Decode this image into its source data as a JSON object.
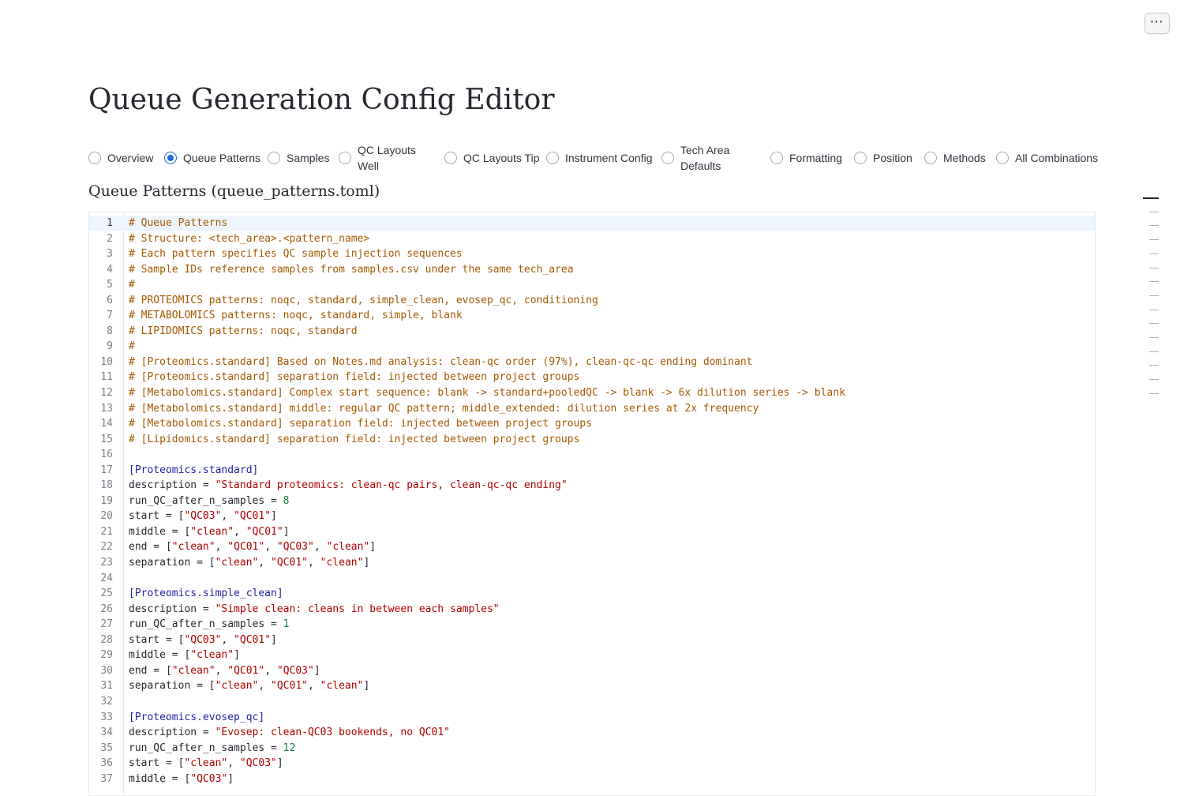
{
  "menu": {
    "label": "···"
  },
  "page": {
    "title": "Queue Generation Config Editor"
  },
  "tabs": [
    {
      "label": "Overview",
      "selected": false
    },
    {
      "label": "Queue Patterns",
      "selected": true
    },
    {
      "label": "Samples",
      "selected": false
    },
    {
      "label": "QC Layouts Well",
      "selected": false
    },
    {
      "label": "QC Layouts Tip",
      "selected": false
    },
    {
      "label": "Instrument Config",
      "selected": false
    },
    {
      "label": "Tech Area Defaults",
      "selected": false
    },
    {
      "label": "Formatting",
      "selected": false
    },
    {
      "label": "Position",
      "selected": false
    },
    {
      "label": "Methods",
      "selected": false
    },
    {
      "label": "All Combinations",
      "selected": false
    }
  ],
  "section": {
    "heading": "Queue Patterns (queue_patterns.toml)"
  },
  "editor": {
    "lines": [
      [
        [
          "c",
          "# Queue Patterns"
        ]
      ],
      [
        [
          "c",
          "# Structure: <tech_area>.<pattern_name>"
        ]
      ],
      [
        [
          "c",
          "# Each pattern specifies QC sample injection sequences"
        ]
      ],
      [
        [
          "c",
          "# Sample IDs reference samples from samples.csv under the same tech_area"
        ]
      ],
      [
        [
          "c",
          "#"
        ]
      ],
      [
        [
          "c",
          "# PROTEOMICS patterns: noqc, standard, simple_clean, evosep_qc, conditioning"
        ]
      ],
      [
        [
          "c",
          "# METABOLOMICS patterns: noqc, standard, simple, blank"
        ]
      ],
      [
        [
          "c",
          "# LIPIDOMICS patterns: noqc, standard"
        ]
      ],
      [
        [
          "c",
          "#"
        ]
      ],
      [
        [
          "c",
          "# [Proteomics.standard] Based on Notes.md analysis: clean-qc order (97%), clean-qc-qc ending dominant"
        ]
      ],
      [
        [
          "c",
          "# [Proteomics.standard] separation field: injected between project groups"
        ]
      ],
      [
        [
          "c",
          "# [Metabolomics.standard] Complex start sequence: blank -> standard+pooledQC -> blank -> 6x dilution series -> blank"
        ]
      ],
      [
        [
          "c",
          "# [Metabolomics.standard] middle: regular QC pattern; middle_extended: dilution series at 2x frequency"
        ]
      ],
      [
        [
          "c",
          "# [Metabolomics.standard] separation field: injected between project groups"
        ]
      ],
      [
        [
          "c",
          "# [Lipidomics.standard] separation field: injected between project groups"
        ]
      ],
      [],
      [
        [
          "h",
          "[Proteomics.standard]"
        ]
      ],
      [
        [
          "p",
          "description = "
        ],
        [
          "s",
          "\"Standard proteomics: clean-qc pairs, clean-qc-qc ending\""
        ]
      ],
      [
        [
          "p",
          "run_QC_after_n_samples = "
        ],
        [
          "n",
          "8"
        ]
      ],
      [
        [
          "p",
          "start = ["
        ],
        [
          "s",
          "\"QC03\""
        ],
        [
          "p",
          ", "
        ],
        [
          "s",
          "\"QC01\""
        ],
        [
          "p",
          "]"
        ]
      ],
      [
        [
          "p",
          "middle = ["
        ],
        [
          "s",
          "\"clean\""
        ],
        [
          "p",
          ", "
        ],
        [
          "s",
          "\"QC01\""
        ],
        [
          "p",
          "]"
        ]
      ],
      [
        [
          "p",
          "end = ["
        ],
        [
          "s",
          "\"clean\""
        ],
        [
          "p",
          ", "
        ],
        [
          "s",
          "\"QC01\""
        ],
        [
          "p",
          ", "
        ],
        [
          "s",
          "\"QC03\""
        ],
        [
          "p",
          ", "
        ],
        [
          "s",
          "\"clean\""
        ],
        [
          "p",
          "]"
        ]
      ],
      [
        [
          "p",
          "separation = ["
        ],
        [
          "s",
          "\"clean\""
        ],
        [
          "p",
          ", "
        ],
        [
          "s",
          "\"QC01\""
        ],
        [
          "p",
          ", "
        ],
        [
          "s",
          "\"clean\""
        ],
        [
          "p",
          "]"
        ]
      ],
      [],
      [
        [
          "h",
          "[Proteomics.simple_clean]"
        ]
      ],
      [
        [
          "p",
          "description = "
        ],
        [
          "s",
          "\"Simple clean: cleans in between each samples\""
        ]
      ],
      [
        [
          "p",
          "run_QC_after_n_samples = "
        ],
        [
          "n",
          "1"
        ]
      ],
      [
        [
          "p",
          "start = ["
        ],
        [
          "s",
          "\"QC03\""
        ],
        [
          "p",
          ", "
        ],
        [
          "s",
          "\"QC01\""
        ],
        [
          "p",
          "]"
        ]
      ],
      [
        [
          "p",
          "middle = ["
        ],
        [
          "s",
          "\"clean\""
        ],
        [
          "p",
          "]"
        ]
      ],
      [
        [
          "p",
          "end = ["
        ],
        [
          "s",
          "\"clean\""
        ],
        [
          "p",
          ", "
        ],
        [
          "s",
          "\"QC01\""
        ],
        [
          "p",
          ", "
        ],
        [
          "s",
          "\"QC03\""
        ],
        [
          "p",
          "]"
        ]
      ],
      [
        [
          "p",
          "separation = ["
        ],
        [
          "s",
          "\"clean\""
        ],
        [
          "p",
          ", "
        ],
        [
          "s",
          "\"QC01\""
        ],
        [
          "p",
          ", "
        ],
        [
          "s",
          "\"clean\""
        ],
        [
          "p",
          "]"
        ]
      ],
      [],
      [
        [
          "h",
          "[Proteomics.evosep_qc]"
        ]
      ],
      [
        [
          "p",
          "description = "
        ],
        [
          "s",
          "\"Evosep: clean-QC03 bookends, no QC01\""
        ]
      ],
      [
        [
          "p",
          "run_QC_after_n_samples = "
        ],
        [
          "n",
          "12"
        ]
      ],
      [
        [
          "p",
          "start = ["
        ],
        [
          "s",
          "\"clean\""
        ],
        [
          "p",
          ", "
        ],
        [
          "s",
          "\"QC03\""
        ],
        [
          "p",
          "]"
        ]
      ],
      [
        [
          "p",
          "middle = ["
        ],
        [
          "s",
          "\"QC03\""
        ],
        [
          "p",
          "]"
        ]
      ]
    ]
  },
  "colors": {
    "accent": "#1c6fdc",
    "comment": "#a35a00",
    "section": "#1f1fa0",
    "string": "#b00000",
    "number": "#137a3d"
  }
}
